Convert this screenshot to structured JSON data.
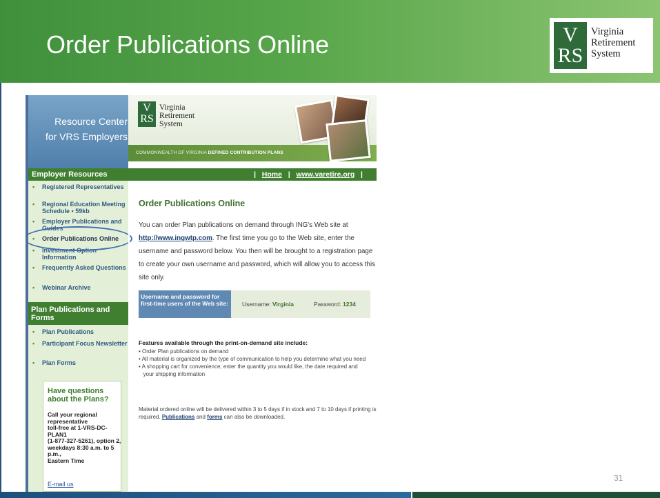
{
  "slide": {
    "title": "Order Publications Online",
    "logo_letters": [
      "V",
      "RS"
    ],
    "logo_name_lines": [
      "Virginia",
      "Retirement",
      "System"
    ],
    "page_number": "31"
  },
  "webpage": {
    "banner": {
      "resource_center_lines": [
        "Resource Center",
        "for VRS Employers"
      ],
      "logo_letters": [
        "V",
        "RS"
      ],
      "logo_name_lines": [
        "Virginia",
        "Retirement",
        "System"
      ],
      "strip_text_plain": "COMMONWEALTH OF VIRGINIA ",
      "strip_text_bold": "DEFINED CONTRIBUTION PLANS"
    },
    "nav_header": "Employer Resources",
    "top_nav": {
      "separator": "|",
      "home": "Home",
      "site": "www.varetire.org"
    },
    "sidebar": {
      "items": [
        {
          "label": "Registered Representatives"
        },
        {
          "label": "Regional Education Meeting Schedule ▪ 59kb"
        },
        {
          "label": "Employer Publications and Guides"
        },
        {
          "label": "Order Publications Online"
        },
        {
          "label": "Investment Option Information"
        },
        {
          "label": "Frequently Asked Questions"
        },
        {
          "label": "Webinar Archive"
        }
      ],
      "section2_title": "Plan Publications and Forms",
      "section2_items": [
        {
          "label": "Plan Publications"
        },
        {
          "label": "Participant Focus Newsletter"
        },
        {
          "label": "Plan Forms"
        }
      ],
      "bullet": "•",
      "questions": {
        "title": "Have questions about the Plans?",
        "body": "Call your regional representative\ntoll-free at 1-VRS-DC-PLAN1\n(1-877-327-5261), option 2,\nweekdays 8:30 a.m. to 5 p.m.,\nEastern Time",
        "email_link": "E-mail us"
      }
    },
    "content": {
      "title": "Order Publications Online",
      "para_1": "You can order Plan publications on demand through ING's Web site at",
      "link_url": "http://www.ingwtp.com",
      "para_2": ". The first time you go to the Web site, enter the username and password below. You then will be brought to a registration page to create your own username and password, which will allow you to access this site only.",
      "cred_label": "Username and password for first-time users of the Web site:",
      "username_label": "Username:",
      "username_value": "Virginia",
      "password_label": "Password:",
      "password_value": "1234",
      "features_head": "Features available through the print-on-demand site include:",
      "features": [
        "• Order Plan publications on demand",
        "• All material is organized by the type of communication to help you determine what you need",
        "• A shopping cart for convenience; enter the quantity you would like, the date required and",
        "   your shipping information"
      ],
      "delivery_1": "Material ordered online will be delivered within 3 to 5 days if in stock and 7 to 10 days if printing is required.",
      "publications_link": "Publications",
      "delivery_and": "and",
      "forms_link": "forms",
      "delivery_2": "can also be downloaded."
    }
  }
}
